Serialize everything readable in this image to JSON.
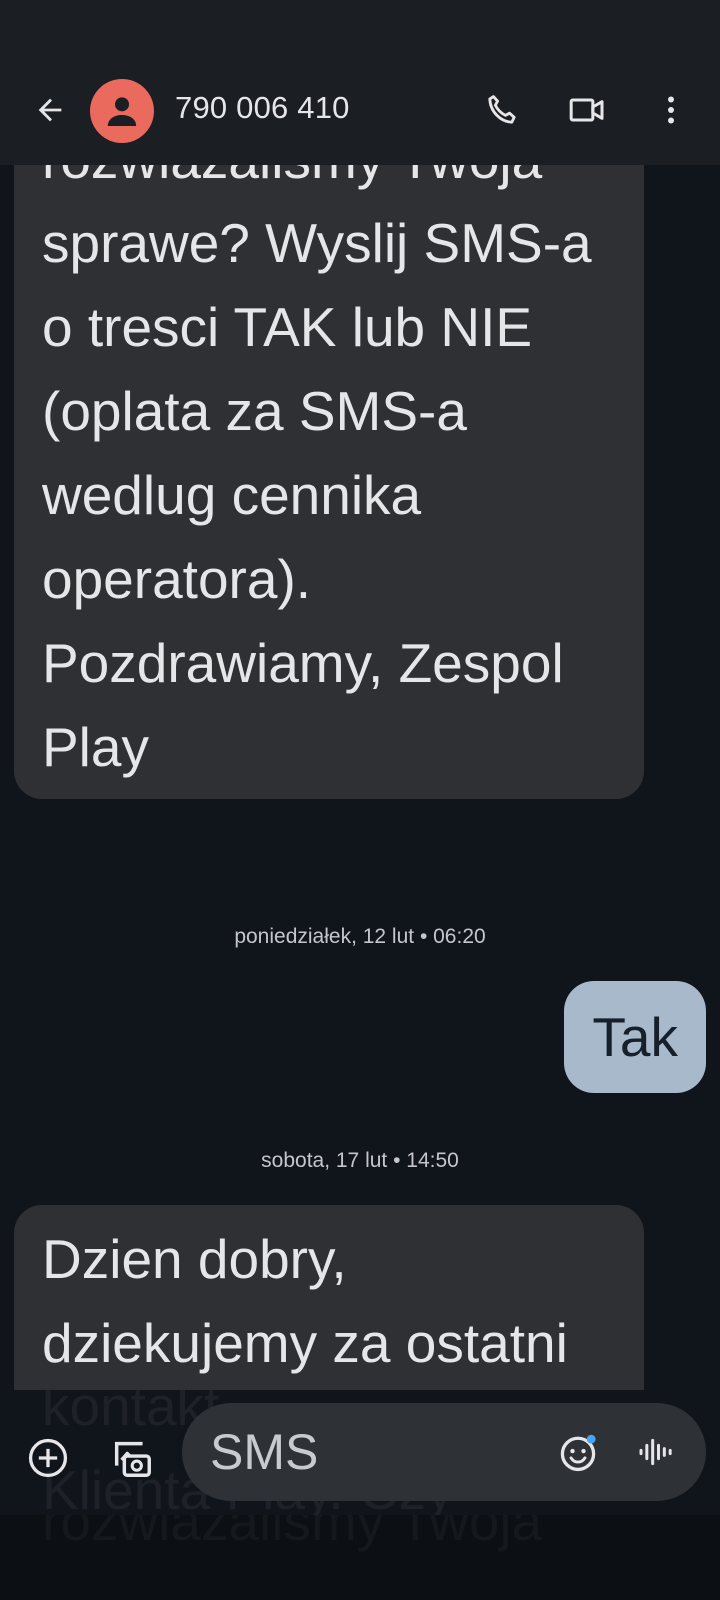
{
  "header": {
    "back_icon": "arrow-back-icon",
    "contact": "790 006 410",
    "avatar_icon": "person-icon",
    "avatar_color": "#ea6a5e",
    "actions": [
      "phone-icon",
      "video-call-icon",
      "more-vert-icon"
    ]
  },
  "messages": {
    "first": {
      "lines": [
        "rozwiazalismy Twoja",
        "sprawe? Wyslij SMS-a",
        "o tresci TAK lub NIE",
        "(oplata za SMS-a",
        "wedlug cennika",
        "operatora).",
        "Pozdrawiamy, Zespol",
        "Play"
      ]
    },
    "timestamp1": "poniedziałek, 12 lut • 06:20",
    "outgoing": "Tak",
    "timestamp2": "sobota, 17 lut • 14:50",
    "second": {
      "lines": [
        "Dzien dobry,",
        "dziekujemy za ostatni"
      ]
    },
    "behind_composer": [
      "kontakt",
      "Klienta Play. Czy",
      "rozwiazalismy Twoja"
    ]
  },
  "composer": {
    "add_icon": "add-circle-icon",
    "gallery_icon": "gallery-camera-icon",
    "placeholder": "SMS",
    "emoji_icon": "emoji-icon",
    "voice_icon": "voice-waveform-icon"
  },
  "colors": {
    "background": "#10151c",
    "header": "#1b1e22",
    "incoming_bubble": "#2e3034",
    "outgoing_bubble": "#a8b9cc",
    "accent_dot": "#4aa3f0"
  }
}
